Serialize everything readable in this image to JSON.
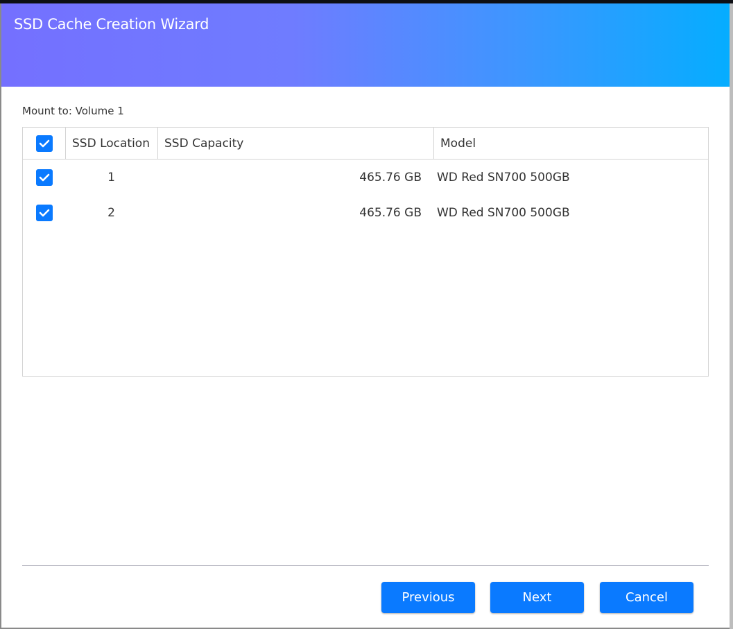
{
  "dialog": {
    "title": "SSD Cache Creation Wizard",
    "mount_label": "Mount to: Volume 1"
  },
  "table": {
    "columns": [
      "SSD Location",
      "SSD Capacity",
      "Model"
    ],
    "rows": [
      {
        "location": "1",
        "capacity": "465.76 GB",
        "model": "WD Red SN700 500GB",
        "checked": true
      },
      {
        "location": "2",
        "capacity": "465.76 GB",
        "model": "WD Red SN700 500GB",
        "checked": true
      }
    ]
  },
  "buttons": {
    "previous": "Previous",
    "next": "Next",
    "cancel": "Cancel"
  },
  "colors": {
    "accent": "#0a7aff",
    "header_start": "#7470ff",
    "header_end": "#05adff"
  }
}
